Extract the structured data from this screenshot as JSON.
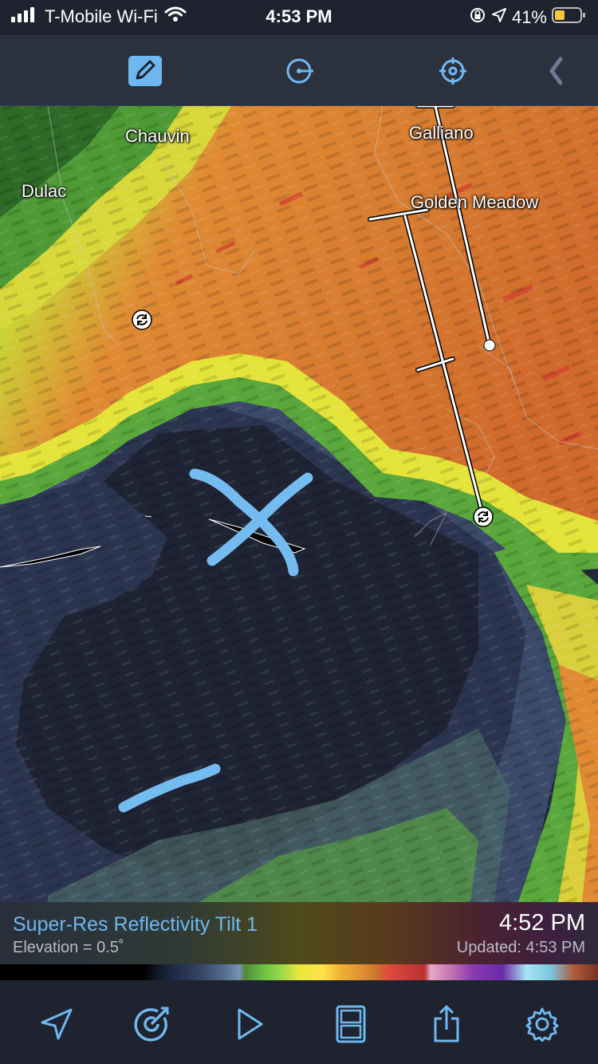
{
  "status_bar": {
    "carrier": "T-Mobile Wi-Fi",
    "time": "4:53 PM",
    "battery": "41%",
    "icons": [
      "signal-bars-icon",
      "wifi-icon",
      "orientation-lock-icon",
      "location-arrow-icon",
      "battery-icon"
    ]
  },
  "toolbar": {
    "icons": [
      "pencil-draw-icon",
      "circle-line-icon",
      "crosshair-target-icon",
      "chevron-left-icon"
    ],
    "accent_color": "#6fb8ef"
  },
  "map": {
    "cities": [
      "Chauvin",
      "Dulac",
      "Galliano",
      "Golden Meadow"
    ],
    "annotation_color": "#74bbf0",
    "radar_colors": [
      "#1d2230",
      "#3a4a6a",
      "#6cc041",
      "#e8e83a",
      "#e08a34",
      "#e04a3a"
    ]
  },
  "info": {
    "product": "Super-Res Reflectivity Tilt 1",
    "elevation": "Elevation = 0.5˚",
    "time": "4:52 PM",
    "updated": "Updated: 4:53 PM"
  },
  "bottom_bar": {
    "icons": [
      "location-arrow-icon",
      "radar-sweep-icon",
      "play-icon",
      "split-layout-icon",
      "share-icon",
      "gear-icon"
    ]
  }
}
